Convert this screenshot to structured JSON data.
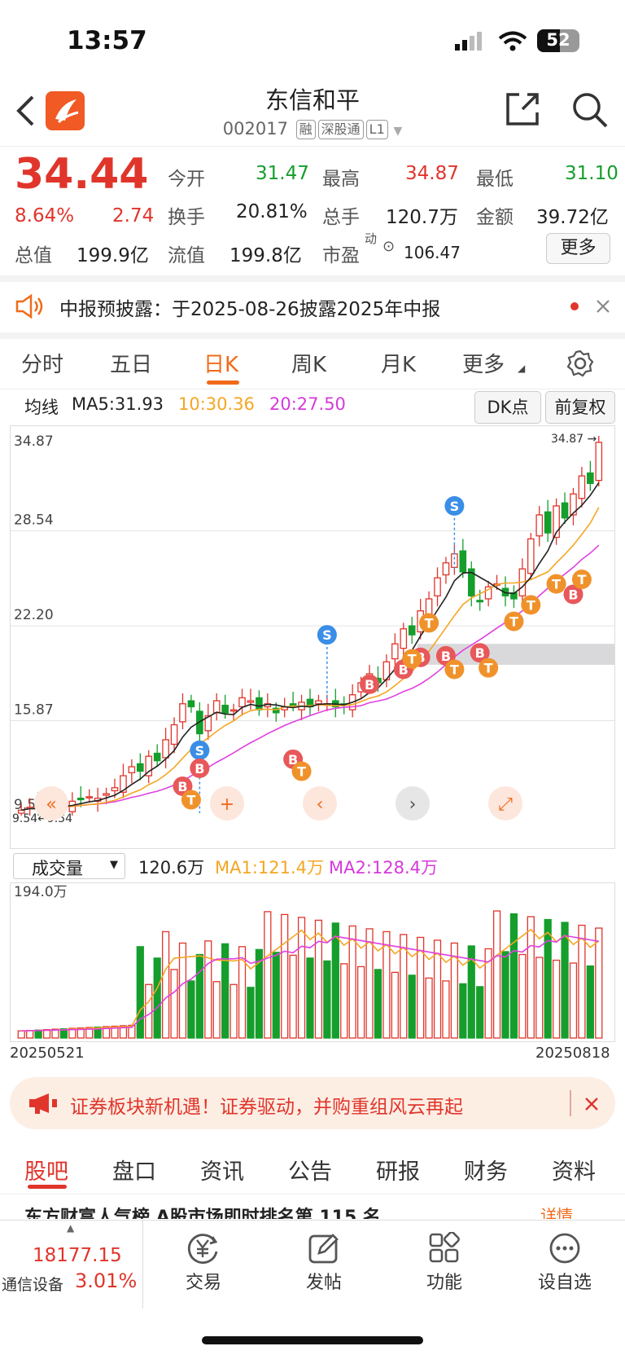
{
  "status_bar": {
    "time": "13:57",
    "battery": "52"
  },
  "header": {
    "title": "东信和平",
    "code": "002017",
    "tags": [
      "融",
      "深股通",
      "L1"
    ]
  },
  "quote": {
    "price": "34.44",
    "change_pct": "8.64%",
    "change": "2.74",
    "open_label": "今开",
    "open": "31.47",
    "high_label": "最高",
    "high": "34.87",
    "low_label": "最低",
    "low": "31.10",
    "turnover_label": "换手",
    "turnover": "20.81%",
    "volume_label": "总手",
    "volume": "120.7万",
    "amount_label": "金额",
    "amount": "39.72亿",
    "mktcap_label": "总值",
    "mktcap": "199.9亿",
    "float_label": "流值",
    "float": "199.8亿",
    "pe_label": "市盈",
    "pe_sup": "动",
    "pe": "106.47",
    "more": "更多"
  },
  "notice": {
    "text": "中报预披露：于2025-08-26披露2025年中报"
  },
  "tabs": [
    "分时",
    "五日",
    "日K",
    "周K",
    "月K",
    "更多"
  ],
  "active_tab": "日K",
  "ma": {
    "label": "均线",
    "ma5": "MA5:31.93",
    "ma10": "10:30.36",
    "ma20": "20:27.50",
    "dk": "DK点",
    "adjust": "前复权"
  },
  "colors": {
    "up": "#e0352b",
    "down": "#159e2c",
    "ma5": "#222222",
    "ma10": "#f5a623",
    "ma20": "#e040e0",
    "accent": "#f06b1a"
  },
  "chart_data": {
    "type": "candlestick",
    "y_ticks": [
      "34.87",
      "28.54",
      "22.20",
      "15.87",
      "9.54"
    ],
    "ylim": [
      9.54,
      34.87
    ],
    "max_label": "34.87",
    "min_label": "9.54",
    "closes": [
      9.9,
      10.1,
      10.0,
      10.2,
      10.3,
      10.1,
      10.5,
      10.6,
      10.8,
      10.7,
      11.0,
      11.4,
      12.2,
      12.8,
      12.5,
      13.5,
      13.2,
      14.6,
      15.6,
      17.0,
      16.8,
      15.0,
      16.2,
      17.2,
      16.4,
      16.6,
      17.4,
      17.2,
      16.6,
      17.0,
      16.4,
      16.8,
      16.9,
      17.1,
      16.8,
      17.2,
      17.0,
      16.8,
      16.9,
      17.6,
      18.4,
      19.0,
      18.4,
      19.8,
      21.0,
      22.0,
      21.6,
      23.2,
      24.0,
      25.4,
      26.4,
      27.0,
      25.8,
      24.2,
      23.8,
      24.8,
      25.0,
      24.2,
      24.0,
      26.0,
      28.0,
      29.6,
      28.4,
      30.2,
      29.4,
      31.0,
      32.2,
      31.7,
      34.44
    ],
    "ma5_last": 31.93,
    "ma10_last": 30.36,
    "ma20_last": 27.5,
    "volume": {
      "label": "成交量",
      "value": "120.6万",
      "ma1": "MA1:121.4万",
      "ma2": "MA2:128.4万",
      "max": "194.0万"
    },
    "start_date": "20250521",
    "end_date": "20250818"
  },
  "banner": {
    "text": "证券板块新机遇！证券驱动，并购重组风云再起"
  },
  "bottom_tabs": [
    "股吧",
    "盘口",
    "资讯",
    "公告",
    "研报",
    "财务",
    "资料"
  ],
  "active_bottom_tab": "股吧",
  "news_peek": {
    "text": "东方财富人气榜 A股市场即时排名第 115 名",
    "more": "详情"
  },
  "toolbar": {
    "index_value": "18177.15",
    "index_name": "通信设备",
    "index_change": "3.01%",
    "items": [
      "交易",
      "发帖",
      "功能",
      "设自选"
    ]
  }
}
